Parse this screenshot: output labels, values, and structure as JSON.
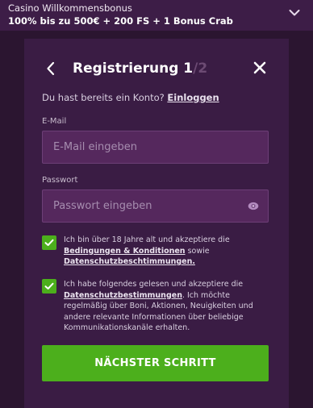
{
  "banner": {
    "title": "Casino Willkommensbonus",
    "offer": "100% bis zu 500€ + 200 FS + 1 Bonus Crab",
    "toggle_icon": "chevron-down-icon"
  },
  "registration": {
    "title": "Registrierung",
    "step_current": "1",
    "step_total": "/2",
    "back_icon": "chevron-left-icon",
    "close_icon": "close-icon",
    "login_prompt": "Du hast bereits ein Konto?",
    "login_link": "Einloggen",
    "email": {
      "label": "E-Mail",
      "placeholder": "E-Mail eingeben",
      "value": ""
    },
    "password": {
      "label": "Passwort",
      "placeholder": "Passwort eingeben",
      "value": "",
      "toggle_icon": "eye-icon"
    },
    "consents": [
      {
        "checked": true,
        "text_before": "Ich bin über 18 Jahre alt und akzeptiere die",
        "link1": "Bedingungen & Konditionen",
        "text_middle": " sowie",
        "link2": "Datenschutzbeschtimmungen."
      },
      {
        "checked": true,
        "text_before": "Ich habe folgendes gelesen und akzeptiere die",
        "link1": "Datenschutzbestimmungen",
        "text_after": ". Ich möchte regelmäßig über Boni, Aktionen, Neuigkeiten und andere relevante Informationen über beliebige Kommunikationskanäle erhalten."
      }
    ],
    "next_button": "NÄCHSTER SCHRITT"
  },
  "colors": {
    "page_background": "#2b1530",
    "banner_background": "#3d1d47",
    "panel_background": "#3a1c44",
    "input_background": "#55285d",
    "accent_green": "#4caf1c"
  }
}
